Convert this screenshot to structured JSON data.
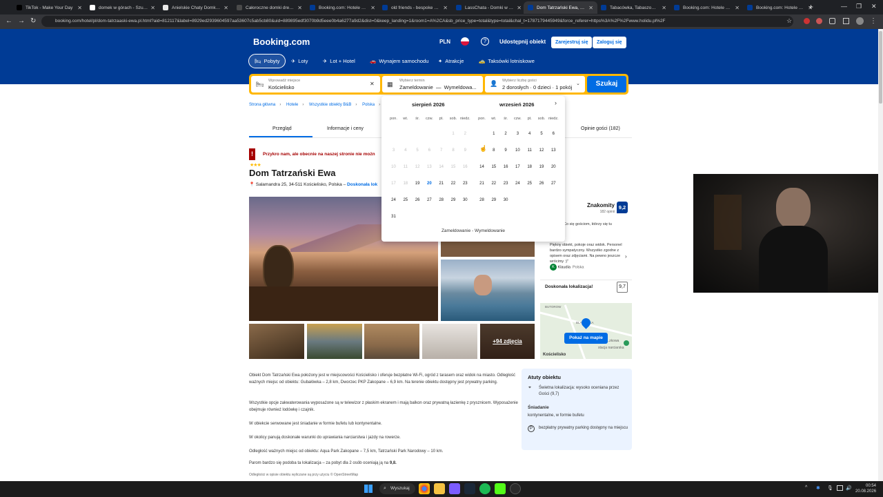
{
  "browser": {
    "tabs": [
      {
        "title": "TikTok - Make Your Day",
        "icon": "tiktok-icon",
        "color": "#000000"
      },
      {
        "title": "domek w górach - Szukaj",
        "icon": "google-icon",
        "color": "#ffffff"
      },
      {
        "title": "Anielskie Chaty Domki Ap",
        "icon": "page-icon",
        "color": "#e8e8e8"
      },
      {
        "title": "Całoroczne domki drewn",
        "icon": "page-icon",
        "color": "#4a4a4a"
      },
      {
        "title": "Booking.com: Hotele – Za",
        "icon": "booking-icon",
        "color": "#003b95"
      },
      {
        "title": "old friends - bespoke villa",
        "icon": "booking-icon",
        "color": "#003b95"
      },
      {
        "title": "LassChata - Domki w góra",
        "icon": "booking-icon",
        "color": "#003b95"
      },
      {
        "title": "Dom Tatrzański Ewa, Kośc",
        "icon": "booking-icon",
        "color": "#003b95"
      },
      {
        "title": "Tabacówka, Tabaszowa (p",
        "icon": "booking-icon",
        "color": "#003b95"
      },
      {
        "title": "Booking.com: Hotele – Ko",
        "icon": "booking-icon",
        "color": "#003b95"
      },
      {
        "title": "Booking.com: Hotele – Ko",
        "icon": "booking-icon",
        "color": "#003b95"
      }
    ],
    "url": "booking.com/hotel/pl/dom-tatrzaaski-ewa.pl.html?aid=812117&label=8929ed2939604597aa53607c5ab5cb80&uid=889895edf3070b9d5eee0b4a6277a9d2&dist=0&keep_landing=1&room1=A%2CA&sb_price_type=total&type=total&chal_t=1787179445949&force_referer=https%3A%2F%2Fwww.holidu.pl%2F"
  },
  "header": {
    "logo": "Booking.com",
    "currency": "PLN",
    "share": "Udostępnij obiekt",
    "register": "Zarejestruj się",
    "login": "Zaloguj się",
    "nav": [
      "Pobyty",
      "Loty",
      "Lot + Hotel",
      "Wynajem samochodu",
      "Atrakcje",
      "Taksówki lotniskowe"
    ]
  },
  "search": {
    "place_label": "Wprowadź miejsce",
    "place_value": "Kościelisko",
    "date_label": "Wybierz termin",
    "date_checkin": "Zameldowanie",
    "date_sep": "—",
    "date_checkout": "Wymeldowa...",
    "guests_label": "Wybierz liczbę gości",
    "guests_value": "2 dorosłych · 0 dzieci · 1 pokój",
    "button": "Szukaj"
  },
  "breadcrumbs": [
    "Strona główna",
    "Hotele",
    "Wszystkie obiekty B&B",
    "Polska"
  ],
  "page_tabs": [
    "Przegląd",
    "Informacje i ceny",
    "Opinie gości (182)"
  ],
  "property": {
    "warning": "Przykro nam, ale obecnie na naszej stronie nie możn",
    "stars": "★★★",
    "name": "Dom Tatrzański Ewa",
    "address": "Salamandra 25, 34-511 Kościelisko, Polska –",
    "address_link": "Doskonała lok",
    "more_photos": "+94 zdjęcia"
  },
  "calendar": {
    "month1": "sierpień 2026",
    "month2": "wrzesień 2026",
    "dow": [
      "pon.",
      "wt.",
      "śr.",
      "czw.",
      "pt.",
      "sob.",
      "niedz."
    ],
    "footer": "Zameldowanie - Wymeldowanie",
    "aug_rows": [
      [
        "",
        "",
        "",
        "",
        "",
        "1",
        "2"
      ],
      [
        "3",
        "4",
        "5",
        "6",
        "7",
        "8",
        "9"
      ],
      [
        "10",
        "11",
        "12",
        "13",
        "14",
        "15",
        "16"
      ],
      [
        "17",
        "18",
        "19",
        "20",
        "21",
        "22",
        "23"
      ],
      [
        "24",
        "25",
        "26",
        "27",
        "28",
        "29",
        "30"
      ],
      [
        "31",
        "",
        "",
        "",
        "",
        "",
        ""
      ]
    ],
    "sep_rows": [
      [
        "",
        "1",
        "2",
        "3",
        "4",
        "5",
        "6"
      ],
      [
        "7",
        "8",
        "9",
        "10",
        "11",
        "12",
        "13"
      ],
      [
        "14",
        "15",
        "16",
        "17",
        "18",
        "19",
        "20"
      ],
      [
        "21",
        "22",
        "23",
        "24",
        "25",
        "26",
        "27"
      ],
      [
        "28",
        "29",
        "30",
        "",
        "",
        "",
        ""
      ]
    ],
    "aug_disabled_through": 18,
    "aug_today": 20
  },
  "reviews": {
    "label": "Znakomity",
    "count": "182 opinii",
    "score": "9,2",
    "intro": "Co się gościom, którzy się tu",
    "text": "Piękny obiekt, pokoje oraz widok. Personel bardzo sympatyczny. Wszystko zgodne z opisem oraz zdjęciami. Na pewno jeszcze wrócimy :)\"",
    "reviewer": "Klaudia",
    "reviewer_initial": "K",
    "country": "Polska",
    "location_label": "Doskonała lokalizacja!",
    "location_score": "9,7"
  },
  "map": {
    "button": "Pokaż na mapie",
    "labels": [
      "BUTOROW",
      "BLAS...WKA",
      "...zkowa",
      "stacja narciarska",
      "Kościelisko"
    ]
  },
  "description": [
    "Obiekt Dom Tatrzański Ewa położony jest w miejscowości Kościelisko i oferuje bezpłatne Wi-Fi, ogród z tarasem oraz widok na miasto. Odległość ważnych miejsc od obiektu: Gubałówka – 2,8 km, Dworzec PKP Zakopane – 6,9 km. Na terenie obiektu dostępny jest prywatny parking.",
    "Wszystkie opcje zakwaterowania wyposażone są w telewizor z płaskim ekranem i mają balkon oraz prywatną łazienkę z prysznicem. Wyposażenie obejmuje również lodówkę i czajnik.",
    "W obiekcie serwowane jest śniadanie w formie bufetu lub kontynentalne.",
    "W okolicy panują doskonałe warunki do uprawiania narciarstwa i jazdy na rowerze.",
    "Odległość ważnych miejsc od obiektu: Aqua Park Zakopane – 7,5 km, Tatrzański Park Narodowy – 10 km.",
    "Parom bardzo się podoba ta lokalizacja – za pobyt dla 2 osób oceniają ją na",
    "Odległości w opisie obiektu wyliczane są przy użyciu © OpenStreetMap"
  ],
  "description_score": "9,8.",
  "highlights": {
    "title": "Atuty obiektu",
    "location": "Świetna lokalizacja: wysoko oceniana przez Gości (9,7)",
    "breakfast_title": "Śniadanie",
    "breakfast": "kontynentalne, w formie bufetu",
    "parking": "bezpłatny prywatny parking dostępny na miejscu"
  },
  "taskbar": {
    "search": "Wyszukaj",
    "time": "00:54",
    "date": "20.08.2026"
  }
}
